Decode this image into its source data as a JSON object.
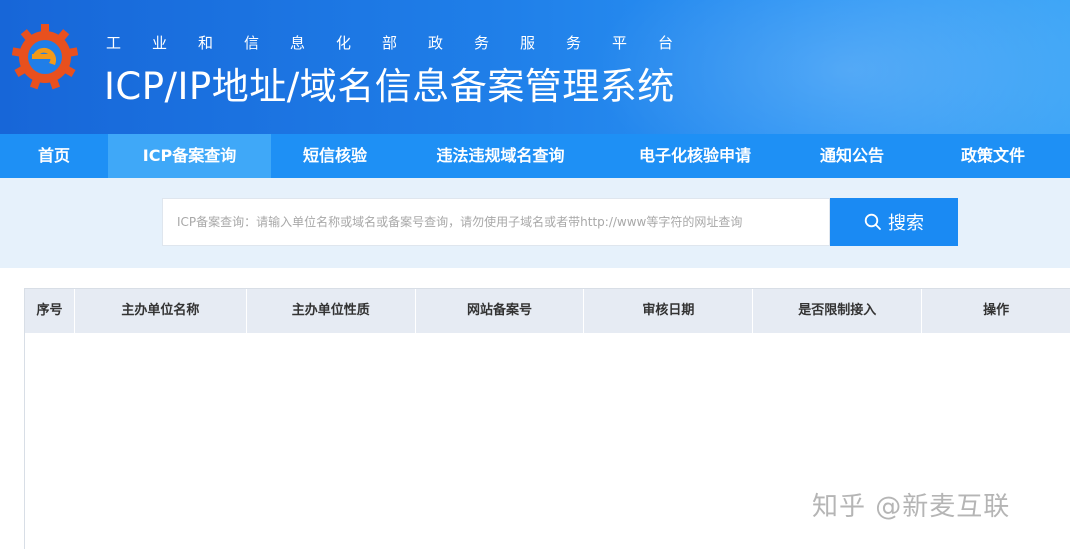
{
  "header": {
    "subtitle": "工业和信息化部政务服务平台",
    "title": "ICP/IP地址/域名信息备案管理系统",
    "logo_icon": "miit-gear-logo-icon"
  },
  "nav": {
    "items": [
      {
        "label": "首页",
        "active": false
      },
      {
        "label": "ICP备案查询",
        "active": true
      },
      {
        "label": "短信核验",
        "active": false
      },
      {
        "label": "违法违规域名查询",
        "active": false
      },
      {
        "label": "电子化核验申请",
        "active": false
      },
      {
        "label": "通知公告",
        "active": false
      },
      {
        "label": "政策文件",
        "active": false
      }
    ]
  },
  "search": {
    "placeholder": "ICP备案查询：请输入单位名称或域名或备案号查询，请勿使用子域名或者带http://www等字符的网址查询",
    "value": "",
    "button_label": "搜索",
    "button_icon": "search-icon"
  },
  "table": {
    "columns": [
      "序号",
      "主办单位名称",
      "主办单位性质",
      "网站备案号",
      "审核日期",
      "是否限制接入",
      "操作"
    ],
    "rows": []
  },
  "watermark": "知乎 @新麦互联",
  "colors": {
    "nav_bg": "#1e90f5",
    "nav_active": "#3fa8f8",
    "search_button": "#1a8af3",
    "search_band": "#e6f1fb",
    "table_header": "#e6ebf3"
  }
}
